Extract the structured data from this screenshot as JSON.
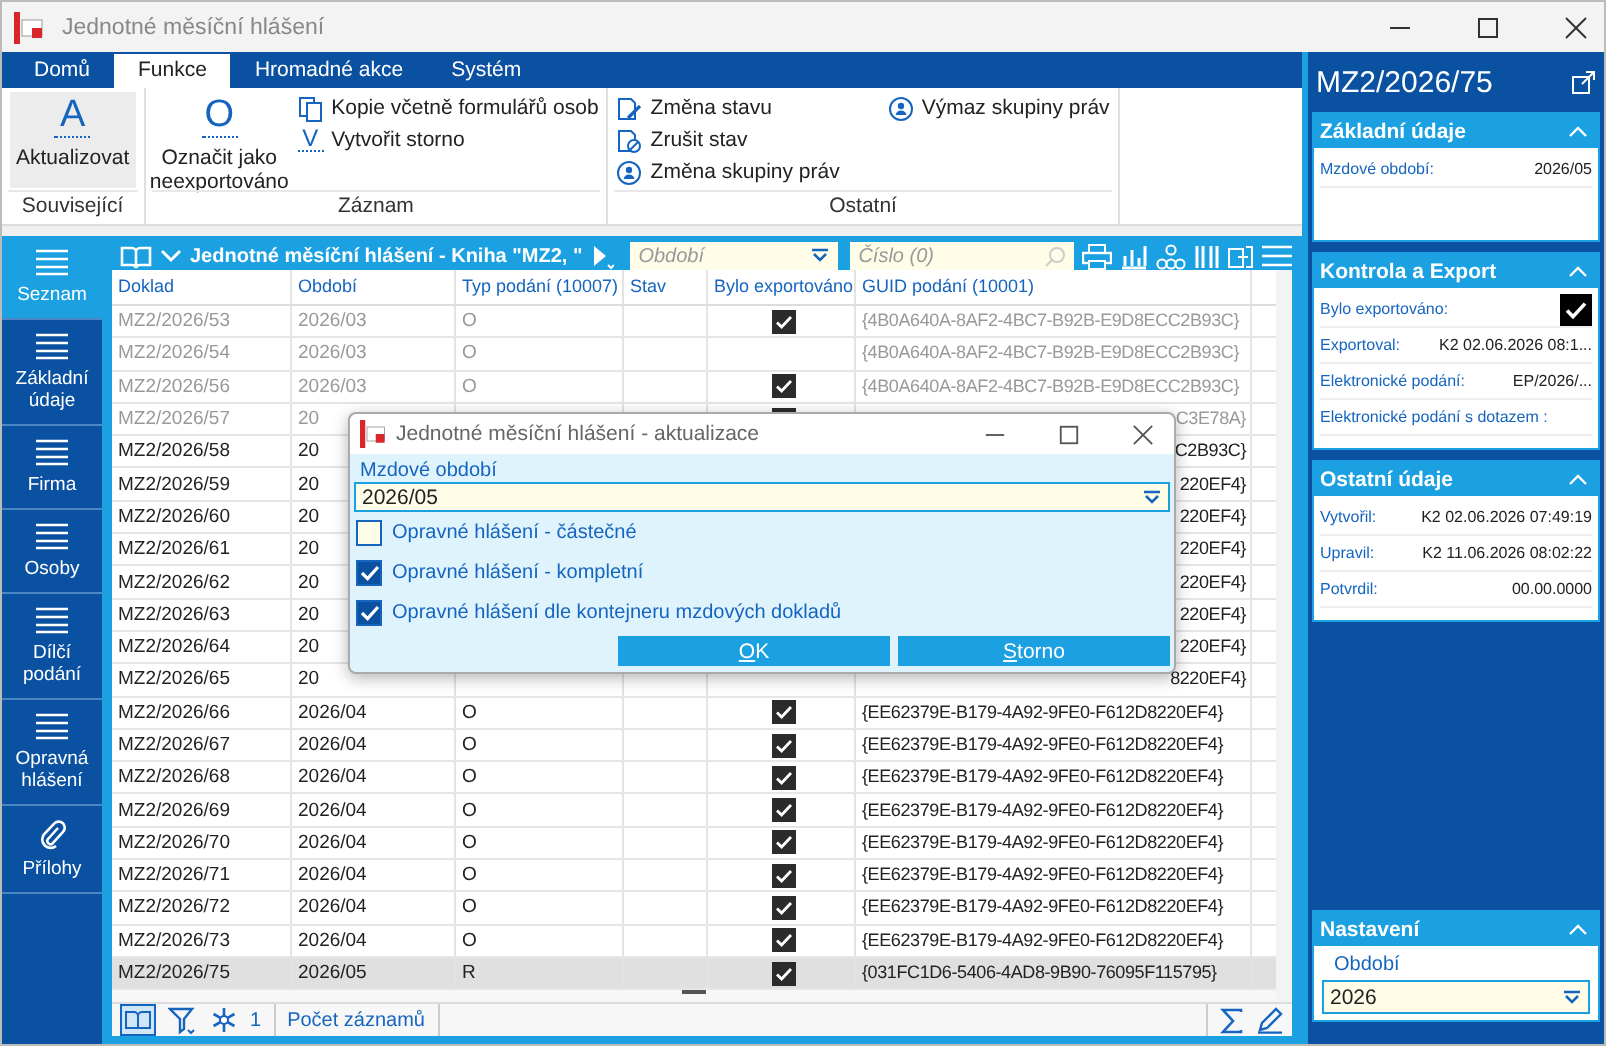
{
  "window": {
    "title": "Jednotné měsíční hlášení"
  },
  "ribbon": {
    "tabs": [
      {
        "label": "Domů",
        "selected": false
      },
      {
        "label": "Funkce",
        "selected": true
      },
      {
        "label": "Hromadné akce",
        "selected": false
      },
      {
        "label": "Systém",
        "selected": false
      }
    ],
    "groups": [
      {
        "label": "Související",
        "items": [
          {
            "label": "Aktualizovat",
            "kind": "large",
            "glyph": "A"
          }
        ]
      },
      {
        "label": "Záznam",
        "items": [
          {
            "label": "Označit jako neexportováno",
            "kind": "large",
            "glyph": "O"
          },
          {
            "label": "Kopie včetně formulářů osob",
            "kind": "copy"
          },
          {
            "label": "Vytvořit storno",
            "kind": "glyph",
            "glyph": "V"
          }
        ]
      },
      {
        "label": "Ostatní",
        "items": [
          {
            "label": "Změna stavu",
            "kind": "doc-edit"
          },
          {
            "label": "Zrušit stav",
            "kind": "doc-cancel"
          },
          {
            "label": "Změna skupiny práv",
            "kind": "rights"
          },
          {
            "label": "Výmaz skupiny práv",
            "kind": "rights"
          }
        ]
      }
    ]
  },
  "nav": [
    {
      "label": "Seznam",
      "kind": "list",
      "selected": true
    },
    {
      "label": "Základní údaje",
      "kind": "list",
      "selected": false
    },
    {
      "label": "Firma",
      "kind": "list",
      "selected": false
    },
    {
      "label": "Osoby",
      "kind": "list",
      "selected": false
    },
    {
      "label": "Dílčí podání",
      "kind": "list",
      "selected": false
    },
    {
      "label": "Opravná hlášení",
      "kind": "list",
      "selected": false
    },
    {
      "label": "Přílohy",
      "kind": "attachment",
      "selected": false
    }
  ],
  "grid": {
    "title": "Jednotné měsíční hlášení - Kniha \"MZ2, \"",
    "period_filter": {
      "placeholder": "Období"
    },
    "number_filter": {
      "placeholder": "Číslo (0)"
    },
    "columns": [
      "Doklad",
      "Období",
      "Typ podání (10007)",
      "Stav",
      "Bylo exportováno",
      "GUID podání (10001)"
    ],
    "rows": [
      {
        "doklad": "MZ2/2026/53",
        "period": "2026/03",
        "type": "O",
        "exported": true,
        "guid": "{4B0A640A-8AF2-4BC7-B92B-E9D8ECC2B93C}",
        "dimmed": true,
        "covered": false,
        "selected": false
      },
      {
        "doklad": "MZ2/2026/54",
        "period": "2026/03",
        "type": "O",
        "exported": false,
        "guid": "{4B0A640A-8AF2-4BC7-B92B-E9D8ECC2B93C}",
        "dimmed": true,
        "covered": false,
        "selected": false
      },
      {
        "doklad": "MZ2/2026/56",
        "period": "2026/03",
        "type": "O",
        "exported": true,
        "guid": "{4B0A640A-8AF2-4BC7-B92B-E9D8ECC2B93C}",
        "dimmed": true,
        "covered": false,
        "selected": false
      },
      {
        "doklad": "MZ2/2026/57",
        "period": "20",
        "exported": true,
        "guid": "C3E78A}",
        "dimmed": true,
        "covered": true,
        "selected": false
      },
      {
        "doklad": "MZ2/2026/58",
        "period": "20",
        "guid": "C2B93C}",
        "dimmed": false,
        "covered": true,
        "selected": false
      },
      {
        "doklad": "MZ2/2026/59",
        "period": "20",
        "guid": "220EF4}",
        "dimmed": false,
        "covered": true,
        "selected": false
      },
      {
        "doklad": "MZ2/2026/60",
        "period": "20",
        "guid": "220EF4}",
        "dimmed": false,
        "covered": true,
        "selected": false
      },
      {
        "doklad": "MZ2/2026/61",
        "period": "20",
        "guid": "220EF4}",
        "dimmed": false,
        "covered": true,
        "selected": false
      },
      {
        "doklad": "MZ2/2026/62",
        "period": "20",
        "guid": "220EF4}",
        "dimmed": false,
        "covered": true,
        "selected": false
      },
      {
        "doklad": "MZ2/2026/63",
        "period": "20",
        "guid": "220EF4}",
        "dimmed": false,
        "covered": true,
        "selected": false
      },
      {
        "doklad": "MZ2/2026/64",
        "period": "20",
        "guid": "220EF4}",
        "dimmed": false,
        "covered": true,
        "selected": false
      },
      {
        "doklad": "MZ2/2026/65",
        "period": "20",
        "guid": "8220EF4}",
        "dimmed": false,
        "covered": true,
        "selected": false
      },
      {
        "doklad": "MZ2/2026/66",
        "period": "2026/04",
        "type": "O",
        "exported": true,
        "guid": "{EE62379E-B179-4A92-9FE0-F612D8220EF4}",
        "dimmed": false,
        "covered": false,
        "selected": false
      },
      {
        "doklad": "MZ2/2026/67",
        "period": "2026/04",
        "type": "O",
        "exported": true,
        "guid": "{EE62379E-B179-4A92-9FE0-F612D8220EF4}",
        "dimmed": false,
        "covered": false,
        "selected": false
      },
      {
        "doklad": "MZ2/2026/68",
        "period": "2026/04",
        "type": "O",
        "exported": true,
        "guid": "{EE62379E-B179-4A92-9FE0-F612D8220EF4}",
        "dimmed": false,
        "covered": false,
        "selected": false
      },
      {
        "doklad": "MZ2/2026/69",
        "period": "2026/04",
        "type": "O",
        "exported": true,
        "guid": "{EE62379E-B179-4A92-9FE0-F612D8220EF4}",
        "dimmed": false,
        "covered": false,
        "selected": false
      },
      {
        "doklad": "MZ2/2026/70",
        "period": "2026/04",
        "type": "O",
        "exported": true,
        "guid": "{EE62379E-B179-4A92-9FE0-F612D8220EF4}",
        "dimmed": false,
        "covered": false,
        "selected": false
      },
      {
        "doklad": "MZ2/2026/71",
        "period": "2026/04",
        "type": "O",
        "exported": true,
        "guid": "{EE62379E-B179-4A92-9FE0-F612D8220EF4}",
        "dimmed": false,
        "covered": false,
        "selected": false
      },
      {
        "doklad": "MZ2/2026/72",
        "period": "2026/04",
        "type": "O",
        "exported": true,
        "guid": "{EE62379E-B179-4A92-9FE0-F612D8220EF4}",
        "dimmed": false,
        "covered": false,
        "selected": false
      },
      {
        "doklad": "MZ2/2026/73",
        "period": "2026/04",
        "type": "O",
        "exported": true,
        "guid": "{EE62379E-B179-4A92-9FE0-F612D8220EF4}",
        "dimmed": false,
        "covered": false,
        "selected": false
      },
      {
        "doklad": "MZ2/2026/75",
        "period": "2026/05",
        "type": "R",
        "exported": true,
        "guid": "{031FC1D6-5406-4AD8-9B90-76095F115795}",
        "dimmed": false,
        "covered": false,
        "selected": true
      }
    ],
    "status": {
      "count": "1",
      "label": "Počet záznamů"
    }
  },
  "dialog": {
    "title": "Jednotné měsíční hlášení - aktualizace",
    "field_label": "Mzdové období",
    "field_value": "2026/05",
    "options": [
      {
        "label": "Opravné hlášení - částečné",
        "checked": false
      },
      {
        "label": "Opravné hlášení - kompletní",
        "checked": true
      },
      {
        "label": "Opravné hlášení dle kontejneru mzdových dokladů",
        "checked": true
      }
    ],
    "buttons": [
      "OK",
      "Storno"
    ]
  },
  "detail": {
    "title": "MZ2/2026/75",
    "sections": [
      {
        "title": "Základní údaje",
        "expanded": true,
        "fields": [
          {
            "kind": "text",
            "label": "Mzdové období:",
            "value": "2026/05"
          }
        ]
      },
      {
        "title": "Kontrola a Export",
        "expanded": true,
        "fields": [
          {
            "kind": "check",
            "label": "Bylo exportováno:",
            "checked": true
          },
          {
            "kind": "text",
            "label": "Exportoval:",
            "value": "K2 02.06.2026 08:1..."
          },
          {
            "kind": "text",
            "label": "Elektronické podání:",
            "value": "EP/2026/..."
          },
          {
            "kind": "text",
            "label": "Elektronické podání s dotazem :"
          }
        ]
      },
      {
        "title": "Ostatní údaje",
        "expanded": true,
        "fields": [
          {
            "kind": "text",
            "label": "Vytvořil:",
            "value": "K2 02.06.2026 07:49:19"
          },
          {
            "kind": "text",
            "label": "Upravil:",
            "value": "K2 11.06.2026 08:02:22"
          },
          {
            "kind": "text",
            "label": "Potvrdil:",
            "value": "00.00.0000"
          }
        ]
      }
    ],
    "settings": {
      "title": "Nastavení",
      "expanded": true,
      "field_label": "Období",
      "field_value": "2026"
    }
  }
}
